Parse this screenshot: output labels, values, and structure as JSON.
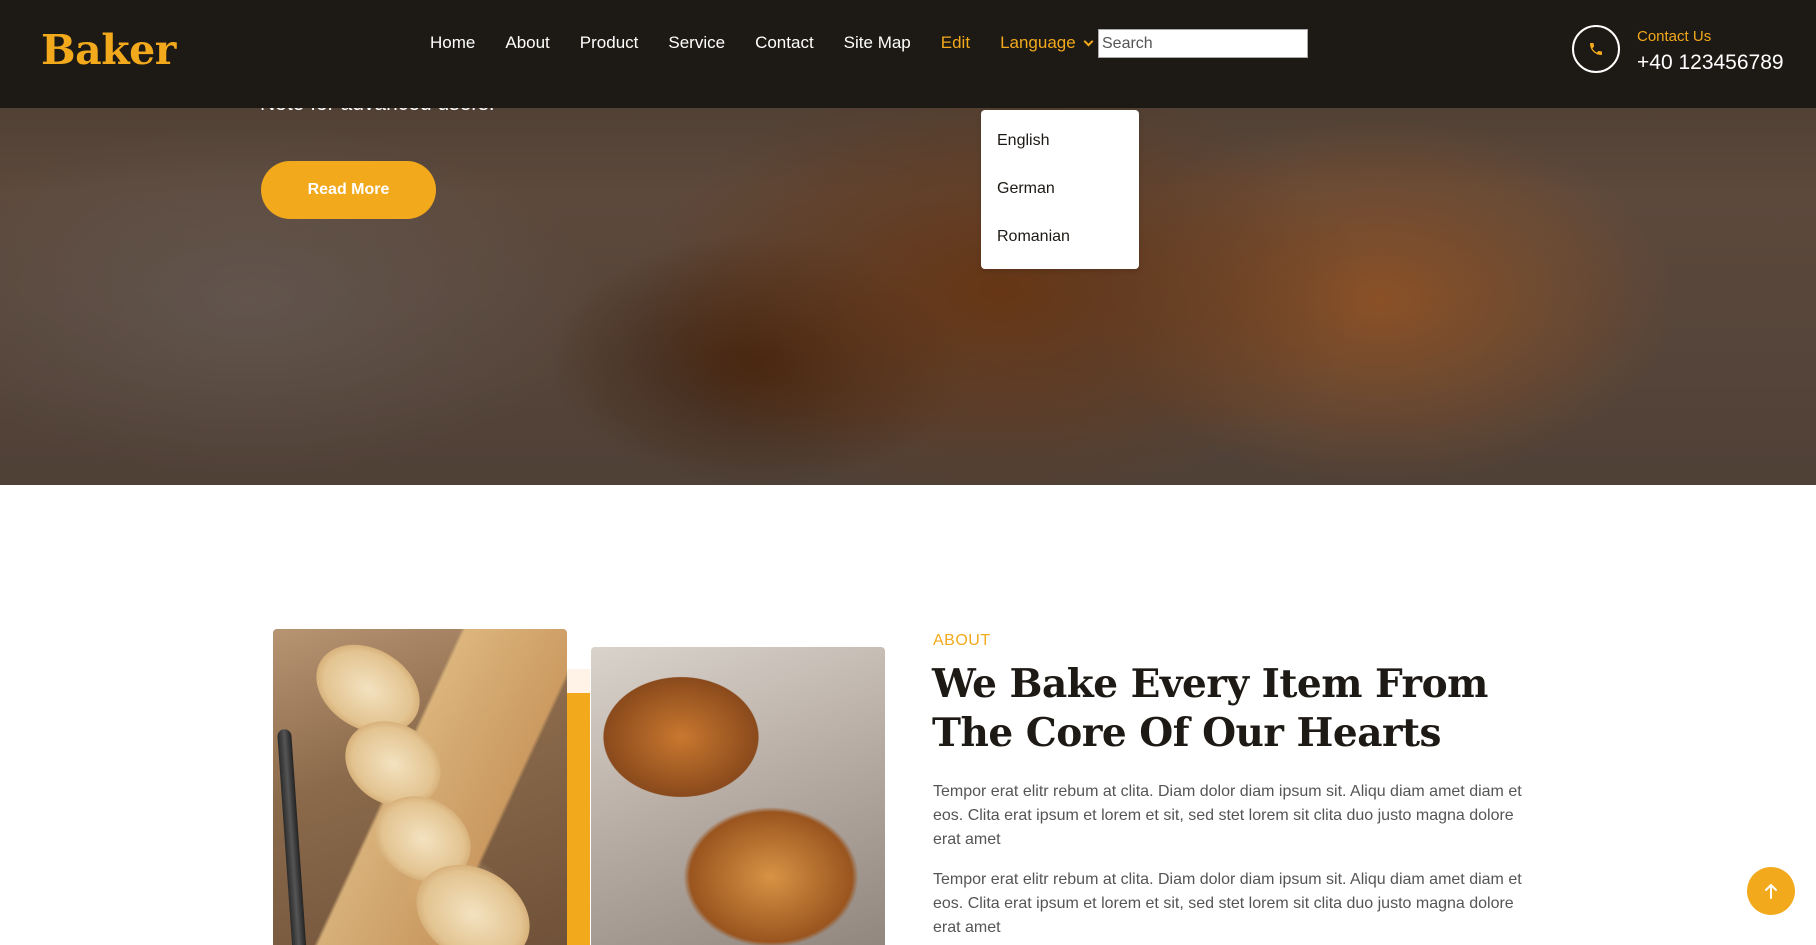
{
  "brand": "Baker",
  "nav": {
    "items": [
      "Home",
      "About",
      "Product",
      "Service",
      "Contact",
      "Site Map",
      "Edit"
    ],
    "language_label": "Language",
    "search_placeholder": "Search"
  },
  "contact": {
    "label": "Contact Us",
    "phone": "+40 123456789"
  },
  "language_menu": [
    "English",
    "German",
    "Romanian"
  ],
  "hero": {
    "text": "Note for advanced users.",
    "button": "Read More"
  },
  "about": {
    "label": "ABOUT",
    "title": "We Bake Every Item From The Core Of Our Hearts",
    "paragraphs": [
      "Tempor erat elitr rebum at clita. Diam dolor diam ipsum sit. Aliqu diam amet diam et eos. Clita erat ipsum et lorem et sit, sed stet lorem sit clita duo justo magna dolore erat amet",
      "Tempor erat elitr rebum at clita. Diam dolor diam ipsum sit. Aliqu diam amet diam et eos. Clita erat ipsum et lorem et sit, sed stet lorem sit clita duo justo magna dolore erat amet"
    ]
  },
  "colors": {
    "accent": "#f2a91c",
    "navbar_bg": "#1d1914",
    "heading": "#1d1914",
    "body_text": "#555555"
  },
  "icons": {
    "contact": "phone-icon",
    "back_to_top": "arrow-up-icon",
    "language": "chevron-down-icon"
  }
}
